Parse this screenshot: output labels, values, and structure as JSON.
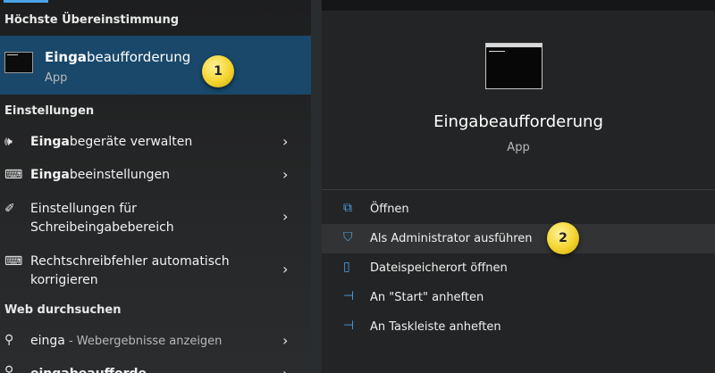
{
  "left": {
    "best_match_heading": "Höchste Übereinstimmung",
    "best_match": {
      "bold": "Einga",
      "rest": "beaufforderung",
      "type": "App",
      "badge": "1"
    },
    "settings_heading": "Einstellungen",
    "settings": [
      {
        "icon": "speaker-icon",
        "glyph": "🕪",
        "bold": "Einga",
        "rest": "begeräte verwalten"
      },
      {
        "icon": "keyboard-icon",
        "glyph": "⌨",
        "bold": "Einga",
        "rest": "beeinstellungen"
      },
      {
        "icon": "pen-icon",
        "glyph": "✐",
        "line1": "Einstellungen für",
        "line2": "Schreibeingabebereich"
      },
      {
        "icon": "keyboard-icon",
        "glyph": "⌨",
        "line1": "Rechtschreibfehler automatisch",
        "line2": "korrigieren"
      }
    ],
    "web_heading": "Web durchsuchen",
    "web": {
      "query": "einga",
      "suffix": " - Webergebnisse anzeigen"
    },
    "partial_bold": "eingabeaufforde"
  },
  "right": {
    "title": "Eingabeaufforderung",
    "subtitle": "App",
    "actions": [
      {
        "icon": "open-icon",
        "glyph": "⧉",
        "label": "Öffnen"
      },
      {
        "icon": "shield-icon",
        "glyph": "⛉",
        "label": "Als Administrator ausführen",
        "badge": "2"
      },
      {
        "icon": "folder-icon",
        "glyph": "▯",
        "label": "Dateispeicherort öffnen"
      },
      {
        "icon": "pin-icon",
        "glyph": "⊣",
        "label": "An \"Start\" anheften"
      },
      {
        "icon": "pin-icon",
        "glyph": "⊣",
        "label": "An Taskleiste anheften"
      }
    ]
  },
  "colors": {
    "accent": "#19486a",
    "badge": "#f3d42d",
    "icon_blue": "#4ca0e8"
  }
}
